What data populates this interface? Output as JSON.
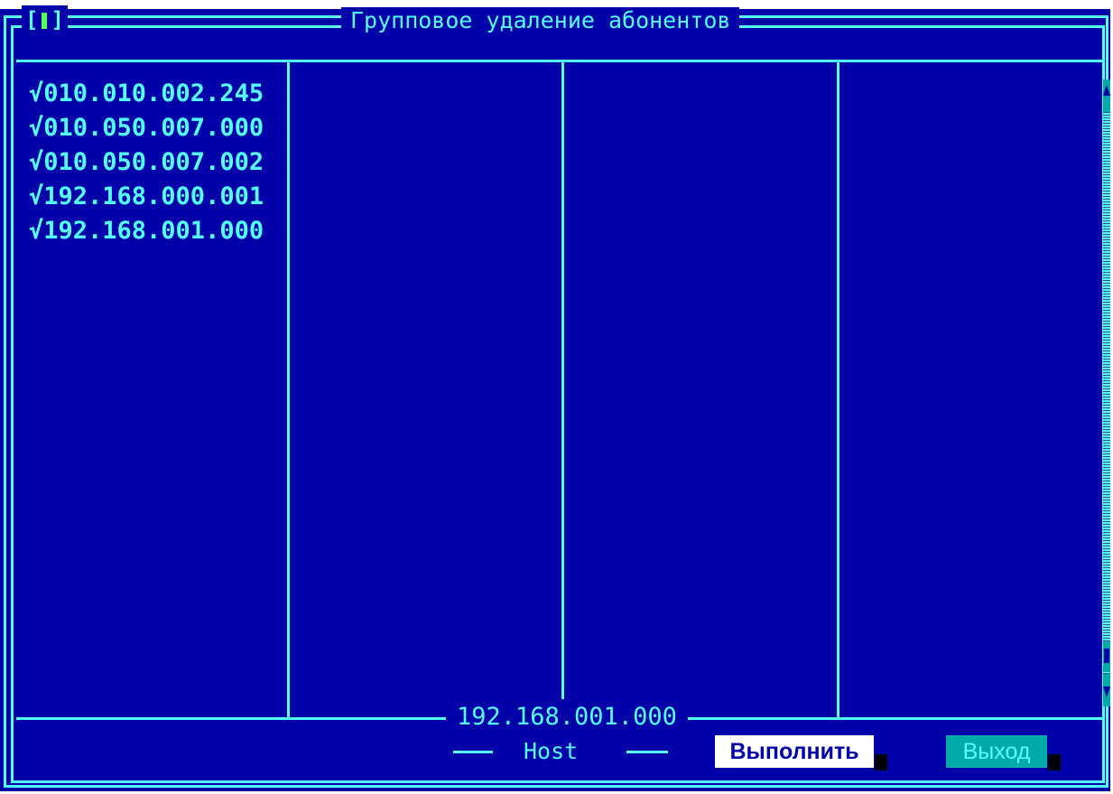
{
  "window": {
    "title": "Групповое удаление абонентов",
    "close_box_left": "[",
    "close_box_right": "]"
  },
  "subscribers": {
    "items": [
      "√010.010.002.245",
      "√010.050.007.000",
      "√010.050.007.002",
      "√192.168.000.001",
      "√192.168.001.000"
    ]
  },
  "footer": {
    "current_address": "192.168.001.000",
    "field_label": "Host"
  },
  "buttons": {
    "execute_label": "Выполнить",
    "exit_label": "Выход"
  },
  "colors": {
    "background": "#0000a8",
    "foreground": "#55ffff",
    "close_mark": "#55ff55",
    "button_default": "#ffffff",
    "button_normal": "#00a8a8"
  }
}
